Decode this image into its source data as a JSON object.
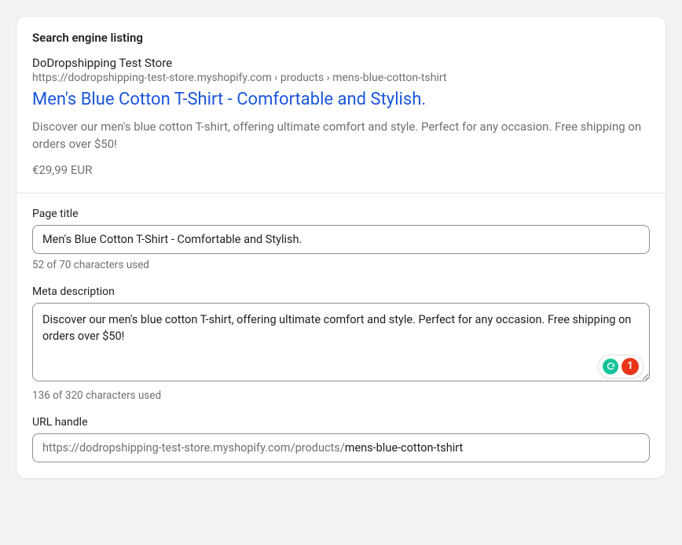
{
  "section_title": "Search engine listing",
  "preview": {
    "store_name": "DoDropshipping Test Store",
    "breadcrumb": "https://dodropshipping-test-store.myshopify.com › products › mens-blue-cotton-tshirt",
    "title": "Men's Blue Cotton T-Shirt - Comfortable and Stylish.",
    "description": "Discover our men's blue cotton T-shirt, offering ultimate comfort and style. Perfect for any occasion. Free shipping on orders over $50!",
    "price": "€29,99 EUR"
  },
  "fields": {
    "page_title": {
      "label": "Page title",
      "value": "Men's Blue Cotton T-Shirt - Comfortable and Stylish.",
      "counter": "52 of 70 characters used"
    },
    "meta_description": {
      "label": "Meta description",
      "value": "Discover our men's blue cotton T-shirt, offering ultimate comfort and style. Perfect for any occasion. Free shipping on orders over $50!",
      "counter": "136 of 320 characters used"
    },
    "url_handle": {
      "label": "URL handle",
      "prefix": "https://dodropshipping-test-store.myshopify.com/products/",
      "value": "mens-blue-cotton-tshirt"
    }
  },
  "grammarly": {
    "count": "1"
  }
}
